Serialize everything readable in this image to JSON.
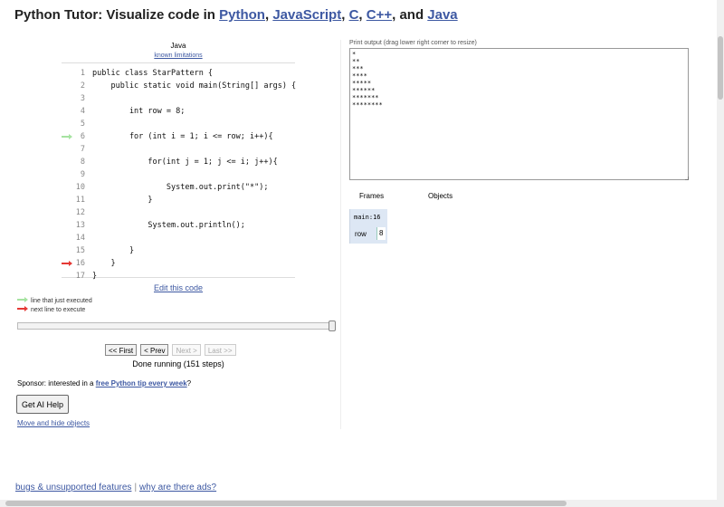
{
  "header": {
    "prefix": "Python Tutor: Visualize code in ",
    "languages": [
      "Python",
      "JavaScript",
      "C",
      "C++",
      "Java"
    ],
    "sep1": ", ",
    "sep2": ", ",
    "sep3": ", ",
    "sep4": ", and "
  },
  "editor": {
    "language": "Java",
    "limitations_link": "known limitations",
    "lines": [
      {
        "num": "1",
        "text": "public class StarPattern {"
      },
      {
        "num": "2",
        "text": "    public static void main(String[] args) {"
      },
      {
        "num": "3",
        "text": ""
      },
      {
        "num": "4",
        "text": "        int row = 8;"
      },
      {
        "num": "5",
        "text": ""
      },
      {
        "num": "6",
        "text": "        for (int i = 1; i <= row; i++){"
      },
      {
        "num": "7",
        "text": ""
      },
      {
        "num": "8",
        "text": "            for(int j = 1; j <= i; j++){"
      },
      {
        "num": "9",
        "text": ""
      },
      {
        "num": "10",
        "text": "                System.out.print(\"*\");"
      },
      {
        "num": "11",
        "text": "            }"
      },
      {
        "num": "12",
        "text": ""
      },
      {
        "num": "13",
        "text": "            System.out.println();"
      },
      {
        "num": "14",
        "text": ""
      },
      {
        "num": "15",
        "text": "        }"
      },
      {
        "num": "16",
        "text": "    }"
      },
      {
        "num": "17",
        "text": "}"
      }
    ],
    "just_executed_line": 6,
    "next_line": 16,
    "edit_link": "Edit this code"
  },
  "legend": {
    "just_executed": "line that just executed",
    "next_line": "next line to execute",
    "green_color": "#a6e3a1",
    "red_color": "#e53935"
  },
  "navigation": {
    "first": "<< First",
    "prev": "< Prev",
    "next": "Next >",
    "last": "Last >>",
    "status": "Done running (151 steps)",
    "slider_position": 1.0
  },
  "sponsor": {
    "prefix": "Sponsor: interested in a ",
    "link": "free Python tip every week",
    "suffix": "?"
  },
  "ai_button": "Get AI Help",
  "move_link": "Move and hide objects",
  "output": {
    "label": "Print output (drag lower right corner to resize)",
    "text": "*\n**\n***\n****\n*****\n******\n*******\n********"
  },
  "frames": {
    "frames_header": "Frames",
    "objects_header": "Objects",
    "frame_name": "main:16",
    "var_name": "row",
    "var_value": "8"
  },
  "footer": {
    "bugs_link": "bugs & unsupported features",
    "separator": "|",
    "ads_link": "why are there ads?"
  }
}
